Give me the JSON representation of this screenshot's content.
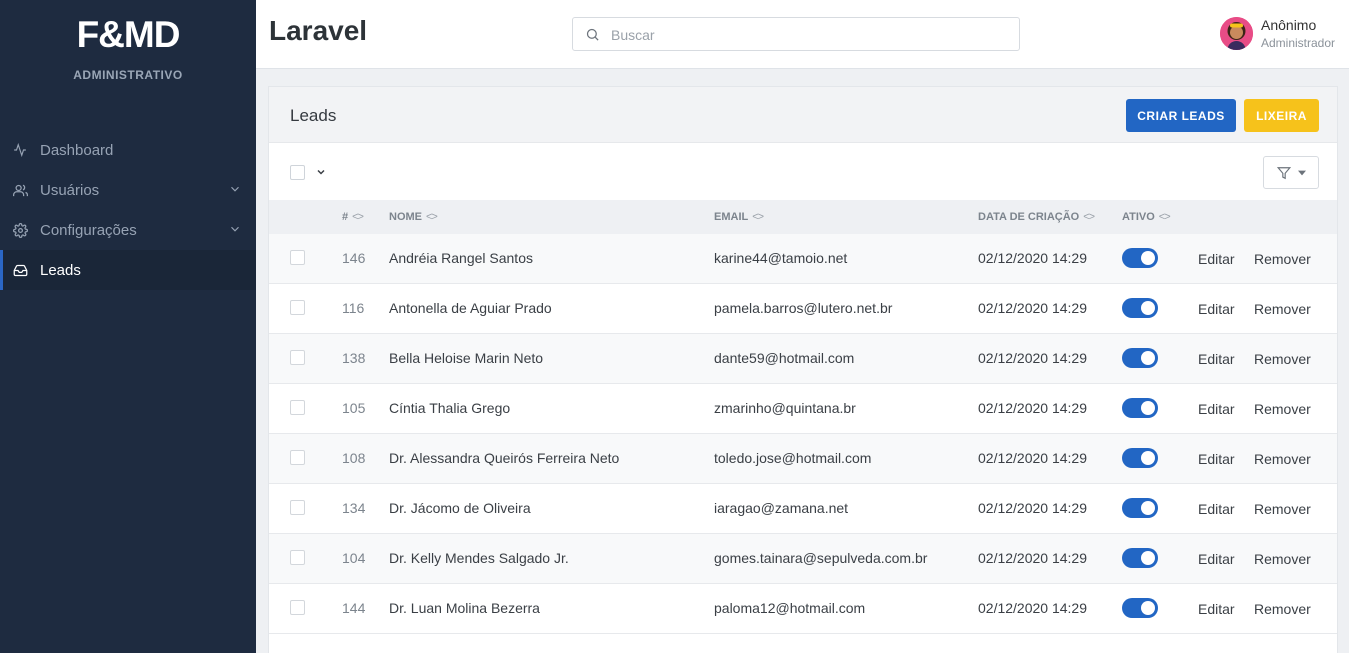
{
  "brand": {
    "logo": "F&MD",
    "subtitle": "ADMINISTRATIVO"
  },
  "sidebar": {
    "items": [
      {
        "label": "Dashboard",
        "icon": "activity-icon",
        "active": false,
        "has_submenu": false
      },
      {
        "label": "Usuários",
        "icon": "users-icon",
        "active": false,
        "has_submenu": true
      },
      {
        "label": "Configurações",
        "icon": "gear-icon",
        "active": false,
        "has_submenu": true
      },
      {
        "label": "Leads",
        "icon": "inbox-icon",
        "active": true,
        "has_submenu": false
      }
    ]
  },
  "header": {
    "title": "Laravel",
    "search": {
      "placeholder": "Buscar",
      "value": ""
    },
    "user": {
      "name": "Anônimo",
      "role": "Administrador"
    }
  },
  "panel": {
    "title": "Leads",
    "create_label": "CRIAR LEADS",
    "trash_label": "LIXEIRA"
  },
  "table": {
    "columns": {
      "id": "#",
      "name": "NOME",
      "email": "EMAIL",
      "date": "DATA DE CRIAÇÃO",
      "active": "ATIVO"
    },
    "edit_label": "Editar",
    "remove_label": "Remover",
    "rows": [
      {
        "id": "146",
        "name": "Andréia Rangel Santos",
        "email": "karine44@tamoio.net",
        "date": "02/12/2020 14:29",
        "active": true
      },
      {
        "id": "116",
        "name": "Antonella de Aguiar Prado",
        "email": "pamela.barros@lutero.net.br",
        "date": "02/12/2020 14:29",
        "active": true
      },
      {
        "id": "138",
        "name": "Bella Heloise Marin Neto",
        "email": "dante59@hotmail.com",
        "date": "02/12/2020 14:29",
        "active": true
      },
      {
        "id": "105",
        "name": "Cíntia Thalia Grego",
        "email": "zmarinho@quintana.br",
        "date": "02/12/2020 14:29",
        "active": true
      },
      {
        "id": "108",
        "name": "Dr. Alessandra Queirós Ferreira Neto",
        "email": "toledo.jose@hotmail.com",
        "date": "02/12/2020 14:29",
        "active": true
      },
      {
        "id": "134",
        "name": "Dr. Jácomo de Oliveira",
        "email": "iaragao@zamana.net",
        "date": "02/12/2020 14:29",
        "active": true
      },
      {
        "id": "104",
        "name": "Dr. Kelly Mendes Salgado Jr.",
        "email": "gomes.tainara@sepulveda.com.br",
        "date": "02/12/2020 14:29",
        "active": true
      },
      {
        "id": "144",
        "name": "Dr. Luan Molina Bezerra",
        "email": "paloma12@hotmail.com",
        "date": "02/12/2020 14:29",
        "active": true
      }
    ]
  },
  "colors": {
    "sidebar_bg": "#1e2b40",
    "primary": "#2266c4",
    "warning": "#f6c21b"
  }
}
